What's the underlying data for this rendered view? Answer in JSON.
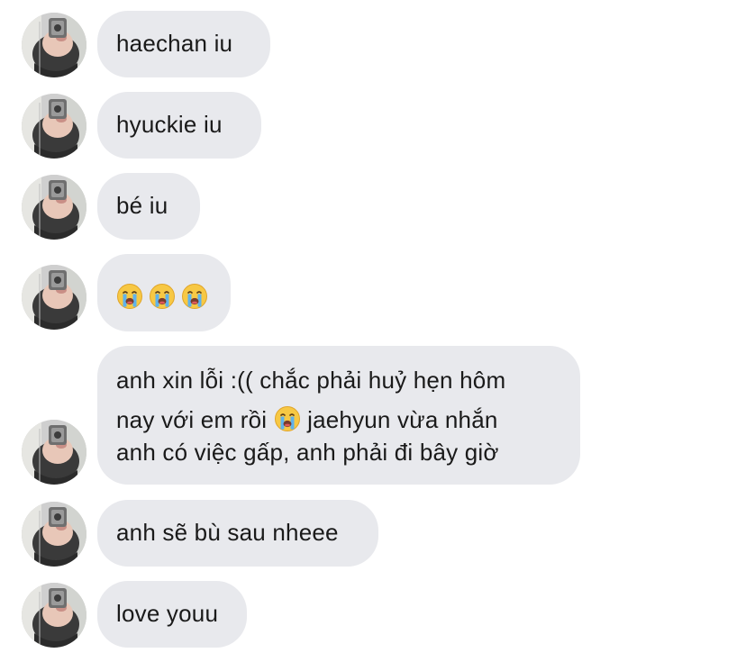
{
  "conversation": {
    "messages": [
      {
        "text": "haechan iu"
      },
      {
        "text": "hyuckie iu"
      },
      {
        "text": "bé iu"
      },
      {
        "emoji": [
          "loudly-crying-face",
          "loudly-crying-face",
          "loudly-crying-face"
        ]
      },
      {
        "lines": [
          "anh xin lỗi :(( chắc phải huỷ hẹn hôm",
          "nay với em rồi",
          "jaehyun vừa nhắn",
          "anh có việc gấp, anh phải đi bây giờ"
        ]
      },
      {
        "text": "anh sẽ bù sau nheee"
      },
      {
        "text": "love youu"
      }
    ]
  },
  "colors": {
    "bubble_bg": "#e8e9ed",
    "text": "#1a1a1a",
    "page_bg": "#ffffff"
  }
}
